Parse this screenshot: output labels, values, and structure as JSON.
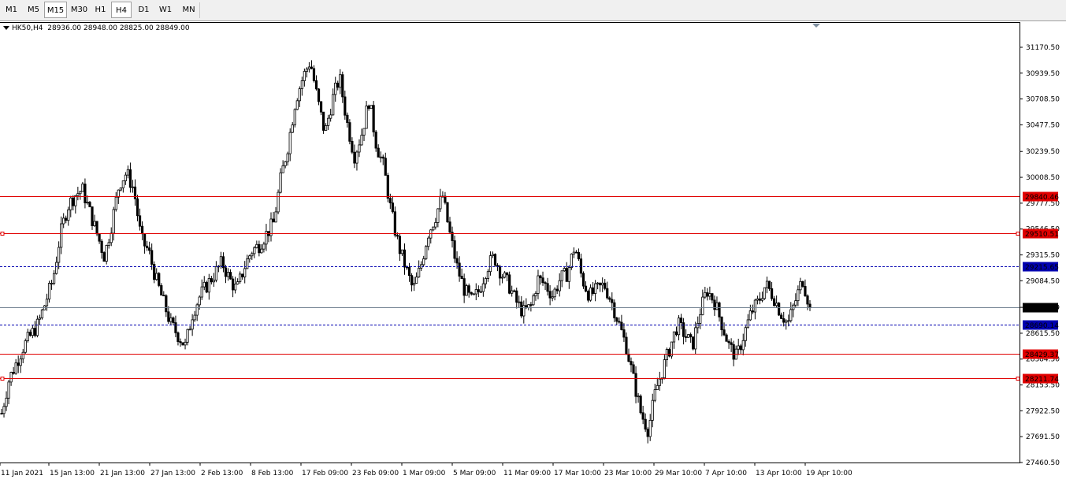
{
  "toolbar": {
    "timeframes": [
      {
        "label": "M1",
        "active": false
      },
      {
        "label": "M5",
        "active": false
      },
      {
        "label": "M15",
        "active": true
      },
      {
        "label": "M30",
        "active": false
      },
      {
        "label": "H1",
        "active": false
      },
      {
        "label": "H4",
        "active": true
      },
      {
        "label": "D1",
        "active": false
      },
      {
        "label": "W1",
        "active": false
      },
      {
        "label": "MN",
        "active": false
      }
    ]
  },
  "chart_header": {
    "symbol": "HK50,H4",
    "ohlc": "28936.00 28948.00 28825.00 28849.00"
  },
  "colors": {
    "background": "#ffffff",
    "candle": "#000000",
    "red_level": "#e00000",
    "blue_level": "#0000b0",
    "current_price_line": "#708090"
  },
  "chart_data": {
    "type": "candlestick",
    "symbol": "HK50",
    "timeframe": "H4",
    "y_ticks": [
      "31170.50",
      "30939.50",
      "30708.50",
      "30477.50",
      "30239.50",
      "30008.50",
      "29777.50",
      "29546.50",
      "29315.50",
      "29084.50",
      "28846.50",
      "28615.50",
      "28384.50",
      "28153.50",
      "27922.50",
      "27691.50",
      "27460.50"
    ],
    "x_ticks": [
      "11 Jan 2021",
      "15 Jan 13:00",
      "21 Jan 13:00",
      "27 Jan 13:00",
      "2 Feb 13:00",
      "8 Feb 13:00",
      "17 Feb 09:00",
      "23 Feb 09:00",
      "1 Mar 09:00",
      "5 Mar 09:00",
      "11 Mar 09:00",
      "17 Mar 10:00",
      "23 Mar 10:00",
      "29 Mar 10:00",
      "7 Apr 10:00",
      "13 Apr 10:00",
      "19 Apr 10:00"
    ],
    "levels": [
      {
        "label": "29840.46",
        "value": 29840.46,
        "style": "solid",
        "color": "red"
      },
      {
        "label": "29510.51",
        "value": 29510.51,
        "style": "solid",
        "color": "red"
      },
      {
        "label": "29215.65",
        "value": 29215.65,
        "style": "dashed",
        "color": "blue"
      },
      {
        "label": "28849.00",
        "value": 28849.0,
        "style": "solid",
        "color": "current"
      },
      {
        "label": "28690.14",
        "value": 28690.14,
        "style": "dashed",
        "color": "blue"
      },
      {
        "label": "28429.37",
        "value": 28429.37,
        "style": "solid",
        "color": "red"
      },
      {
        "label": "28211.74",
        "value": 28211.74,
        "style": "solid",
        "color": "red"
      }
    ],
    "close_path": [
      27900,
      28200,
      28350,
      28500,
      28600,
      28700,
      28900,
      29100,
      29500,
      29750,
      29850,
      29900,
      29700,
      29500,
      29300,
      29600,
      29950,
      30050,
      29900,
      29450,
      29350,
      29100,
      28900,
      28700,
      28600,
      28500,
      28800,
      28950,
      29050,
      29150,
      29250,
      29100,
      29000,
      29200,
      29350,
      29400,
      29500,
      29600,
      30000,
      30300,
      30700,
      30900,
      31050,
      30700,
      30400,
      30700,
      30900,
      30500,
      30200,
      30400,
      30700,
      30300,
      30100,
      29700,
      29400,
      29200,
      29000,
      29200,
      29500,
      29650,
      29850,
      29500,
      29200,
      29000,
      28900,
      29000,
      29200,
      29300,
      29150,
      29050,
      28900,
      28800,
      28850,
      29100,
      29050,
      28950,
      29100,
      29150,
      29400,
      29100,
      28950,
      29000,
      29050,
      28900,
      28700,
      28500,
      28200,
      27900,
      27750,
      28100,
      28300,
      28500,
      28700,
      28600,
      28500,
      28800,
      29000,
      28900,
      28700,
      28500,
      28400,
      28600,
      28800,
      28900,
      29050,
      28950,
      28800,
      28700,
      28900,
      29100,
      28849
    ],
    "title": "",
    "xlabel": "",
    "ylabel": ""
  }
}
